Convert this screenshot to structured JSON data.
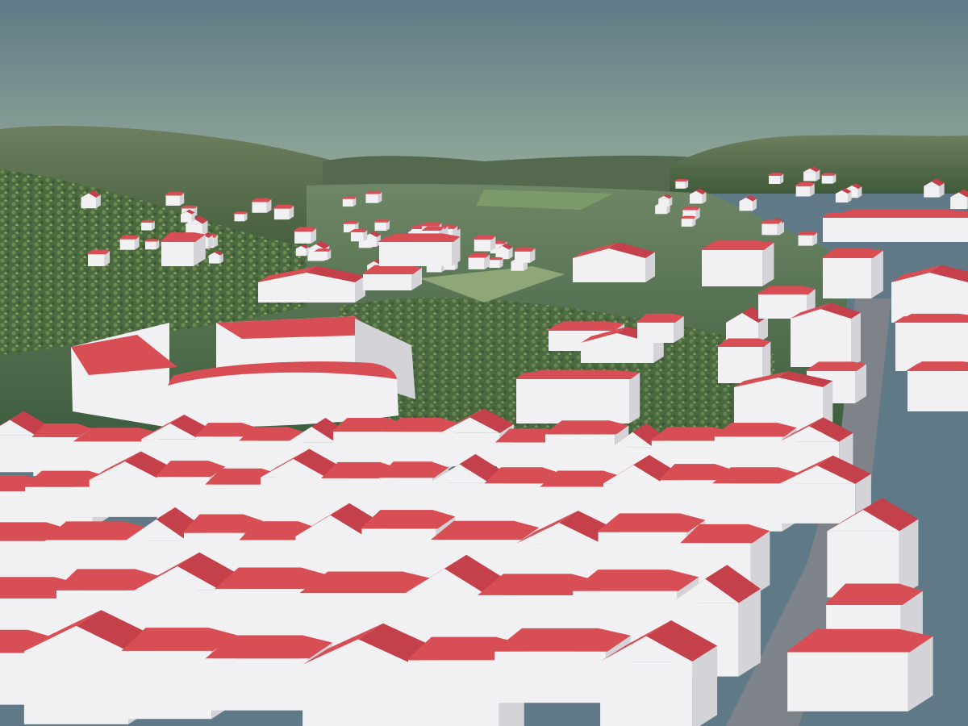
{
  "scene": {
    "kind": "3d-city-model",
    "colors": {
      "sky_top": "#5f7a86",
      "sky_horizon": "#96ad9b",
      "hills_far": "#4a5a48",
      "terrain": "#4f6e44",
      "terrain_light": "#7e9a66",
      "road": "#8a8e8c",
      "roof": "#d84e55",
      "roof_shade": "#c4404a",
      "wall_light": "#f1f1f3",
      "wall_shade": "#d3d3d8"
    },
    "landmarks": [
      "curved-building",
      "hillside-houses",
      "valley",
      "main-street"
    ]
  }
}
